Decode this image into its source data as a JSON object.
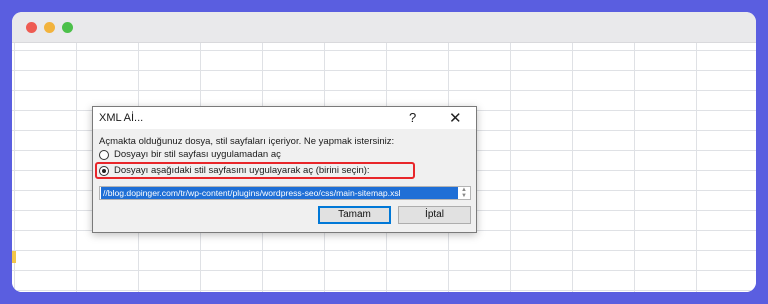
{
  "window": {
    "controls": [
      "close",
      "minimize",
      "maximize"
    ]
  },
  "dialog": {
    "title": "XML Aİ...",
    "help_label": "?",
    "close_label": "✕",
    "message": "Açmakta olduğunuz dosya, stil sayfaları içeriyor. Ne yapmak istersiniz:",
    "option_no_stylesheet": "Dosyayı bir stil sayfası uygulamadan aç",
    "option_with_stylesheet": "Dosyayı aşağıdaki stil sayfasını uygulayarak aç (birini seçin):",
    "selected_option": "option_with_stylesheet",
    "stylesheet_selected": "//blog.dopinger.com/tr/wp-content/plugins/wordpress-seo/css/main-sitemap.xsl",
    "ok_label": "Tamam",
    "cancel_label": "İptal"
  },
  "colors": {
    "background": "#5a5ee0",
    "highlight": "#e8262a",
    "selection": "#1f6fd6"
  }
}
